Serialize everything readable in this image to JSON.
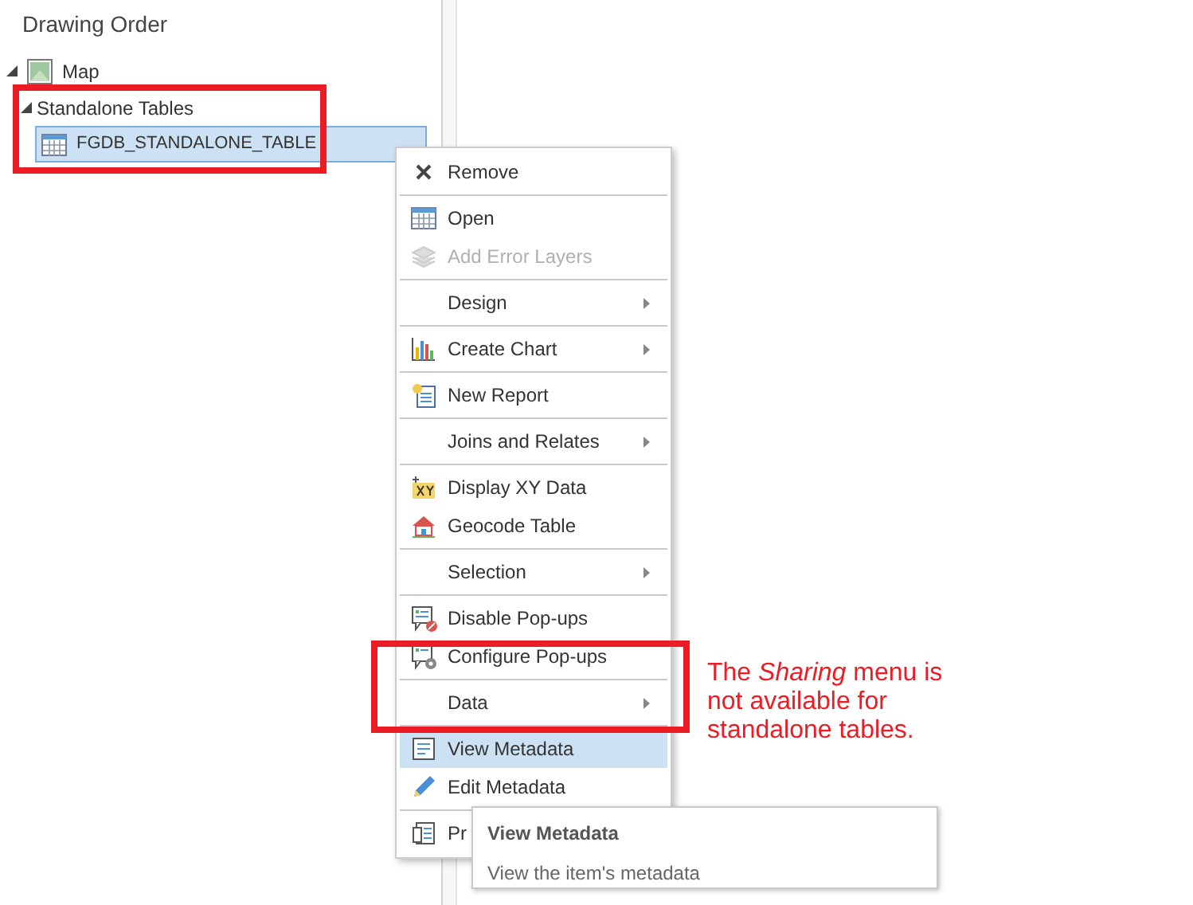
{
  "panel": {
    "title": "Drawing Order",
    "tree": [
      {
        "label": "Map",
        "expanded": true,
        "selected": false,
        "kind": "map"
      },
      {
        "label": "Standalone Tables",
        "expanded": true,
        "selected": false,
        "kind": "group",
        "children": [
          {
            "label": "FGDB_STANDALONE_TABLE",
            "selected": true,
            "kind": "table"
          }
        ]
      }
    ]
  },
  "context_menu": {
    "groups": [
      [
        {
          "label": "Remove",
          "disabled": false,
          "submenu": false,
          "selected": false
        }
      ],
      [
        {
          "label": "Open",
          "disabled": false,
          "submenu": false,
          "selected": false
        },
        {
          "label": "Add Error Layers",
          "disabled": true,
          "submenu": false,
          "selected": false
        }
      ],
      [
        {
          "label": "Design",
          "disabled": false,
          "submenu": true,
          "selected": false
        }
      ],
      [
        {
          "label": "Create Chart",
          "disabled": false,
          "submenu": true,
          "selected": false
        }
      ],
      [
        {
          "label": "New Report",
          "disabled": false,
          "submenu": false,
          "selected": false
        }
      ],
      [
        {
          "label": "Joins and Relates",
          "disabled": false,
          "submenu": true,
          "selected": false
        }
      ],
      [
        {
          "label": "Display XY Data",
          "disabled": false,
          "submenu": false,
          "selected": false
        },
        {
          "label": "Geocode Table",
          "disabled": false,
          "submenu": false,
          "selected": false
        }
      ],
      [
        {
          "label": "Selection",
          "disabled": false,
          "submenu": true,
          "selected": false
        }
      ],
      [
        {
          "label": "Disable Pop-ups",
          "disabled": false,
          "submenu": false,
          "selected": false
        },
        {
          "label": "Configure Pop-ups",
          "disabled": false,
          "submenu": false,
          "selected": false
        }
      ],
      [
        {
          "label": "Data",
          "disabled": false,
          "submenu": true,
          "selected": false
        }
      ],
      [
        {
          "label": "View Metadata",
          "disabled": false,
          "submenu": false,
          "selected": true
        },
        {
          "label": "Edit Metadata",
          "disabled": false,
          "submenu": false,
          "selected": false
        }
      ],
      [
        {
          "label": "Pr",
          "disabled": false,
          "selected": false
        }
      ]
    ]
  },
  "tooltip": {
    "title": "View Metadata",
    "description": "View the item's metadata"
  },
  "annotation": "The *Sharing* menu is not available for standalone tables."
}
